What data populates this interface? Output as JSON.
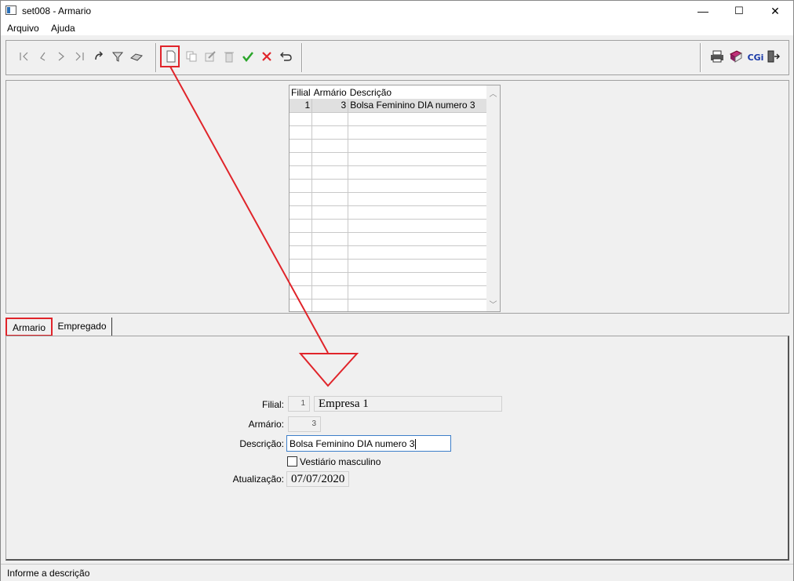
{
  "window": {
    "title": "set008 - Armario",
    "minimize": "—",
    "maximize": "☐",
    "close": "✕"
  },
  "menu": {
    "file": "Arquivo",
    "help": "Ajuda"
  },
  "toolbar": {
    "icons": [
      "first-record-icon",
      "prev-record-icon",
      "next-record-icon",
      "last-record-icon",
      "refresh-icon",
      "filter-icon",
      "search-icon",
      "new-record-icon",
      "copy-icon",
      "edit-icon",
      "delete-icon",
      "confirm-icon",
      "cancel-icon",
      "undo-icon",
      "print-icon",
      "book-icon",
      "cgi-icon",
      "exit-icon"
    ],
    "cgi_label": "CGi",
    "confirm_color": "#2aa52a",
    "cancel_color": "#e0242a"
  },
  "grid": {
    "columns": [
      "Filial",
      "Armário",
      "Descrição"
    ],
    "rows": [
      {
        "filial": "1",
        "armario": "3",
        "descricao": "Bolsa Feminino DIA numero 3"
      }
    ]
  },
  "tabs": {
    "active": "Armario",
    "other": "Empregado"
  },
  "form": {
    "filial_label": "Filial:",
    "filial_value": "1",
    "empresa_value": "Empresa 1",
    "armario_label": "Armário:",
    "armario_value": "3",
    "descricao_label": "Descrição:",
    "descricao_value": "Bolsa Feminino DIA numero 3",
    "vestiario_label": "Vestiário masculino",
    "vestiario_checked": false,
    "atualizacao_label": "Atualização:",
    "atualizacao_value": "07/07/2020"
  },
  "status": {
    "message": "Informe a descrição"
  },
  "annotation_color": "#e0242a"
}
